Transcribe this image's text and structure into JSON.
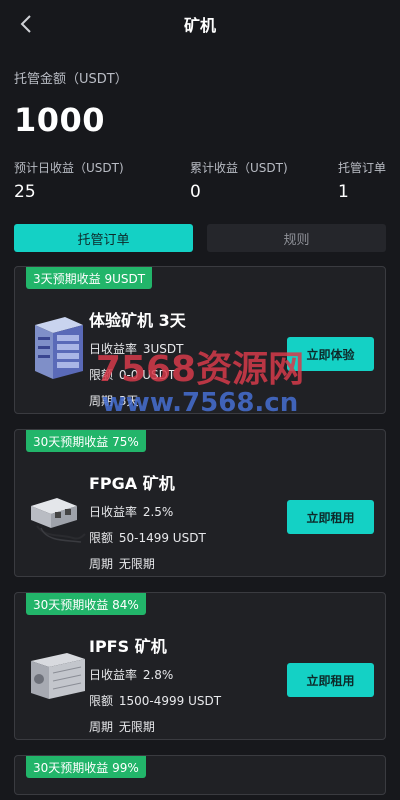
{
  "header": {
    "title": "矿机"
  },
  "summary": {
    "label": "托管金额（USDT）",
    "amount": "1000",
    "stats": [
      {
        "label": "预计日收益（USDT)",
        "value": "25"
      },
      {
        "label": "累计收益（USDT)",
        "value": "0"
      },
      {
        "label": "托管订单",
        "value": "1"
      }
    ]
  },
  "tabs": [
    {
      "label": "托管订单",
      "active": true
    },
    {
      "label": "规则",
      "active": false
    }
  ],
  "cards": [
    {
      "badge": "3天预期收益 9USDT",
      "name": "体验矿机 3天",
      "rate_label": "日收益率",
      "rate": "3USDT",
      "limit_label": "限额",
      "limit": "0-0 USDT",
      "period_label": "周期",
      "period": "3天",
      "cta": "立即体验",
      "image": "server-rack"
    },
    {
      "badge": "30天预期收益 75%",
      "name": "FPGA 矿机",
      "rate_label": "日收益率",
      "rate": "2.5%",
      "limit_label": "限额",
      "limit": "50-1499 USDT",
      "period_label": "周期",
      "period": "无限期",
      "cta": "立即租用",
      "image": "fpga-miner"
    },
    {
      "badge": "30天预期收益 84%",
      "name": "IPFS 矿机",
      "rate_label": "日收益率",
      "rate": "2.8%",
      "limit_label": "限额",
      "limit": "1500-4999 USDT",
      "period_label": "周期",
      "period": "无限期",
      "cta": "立即租用",
      "image": "ipfs-miner"
    },
    {
      "badge": "30天预期收益 99%"
    }
  ],
  "watermark": {
    "line1": "7568资源网",
    "line2": "www.7568.cn"
  },
  "colors": {
    "background": "#17181c",
    "accent": "#14d1c5",
    "badge": "#22b56a",
    "card": "#202125"
  }
}
